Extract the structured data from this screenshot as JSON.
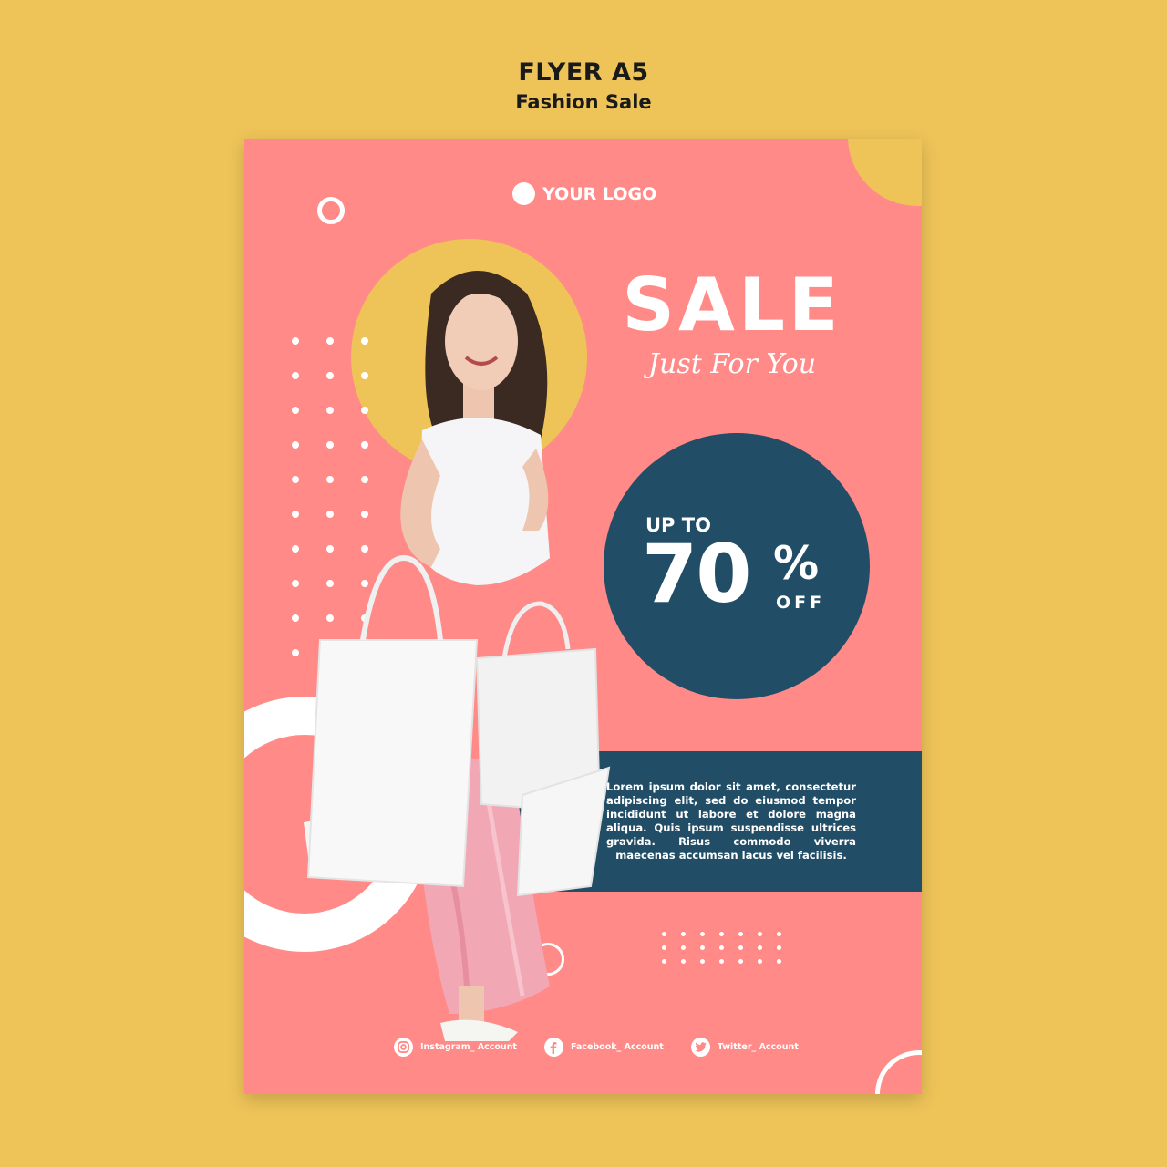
{
  "header": {
    "title": "FLYER A5",
    "subtitle": "Fashion Sale"
  },
  "flyer": {
    "logo_text": "YOUR LOGO",
    "sale_title": "SALE",
    "sale_subtitle": "Just For You",
    "discount": {
      "prefix": "UP TO",
      "number": "70",
      "sign": "%",
      "suffix": "OFF"
    },
    "body_text": "Lorem ipsum dolor sit amet, consectetur adipiscing elit, sed do eiusmod tempor incididunt ut labore et dolore magna aliqua. Quis ipsum suspendisse ultrices gravida. Risus commodo viverra maecenas accumsan lacus vel facilisis.",
    "social": [
      {
        "icon": "instagram-icon",
        "label": "Instagram_ Account"
      },
      {
        "icon": "facebook-icon",
        "label": "Facebook_ Account"
      },
      {
        "icon": "twitter-icon",
        "label": "Twitter_ Account"
      }
    ]
  },
  "colors": {
    "background": "#EEC459",
    "flyer": "#FF8A87",
    "navy": "#224D66",
    "white": "#FFFFFF"
  }
}
